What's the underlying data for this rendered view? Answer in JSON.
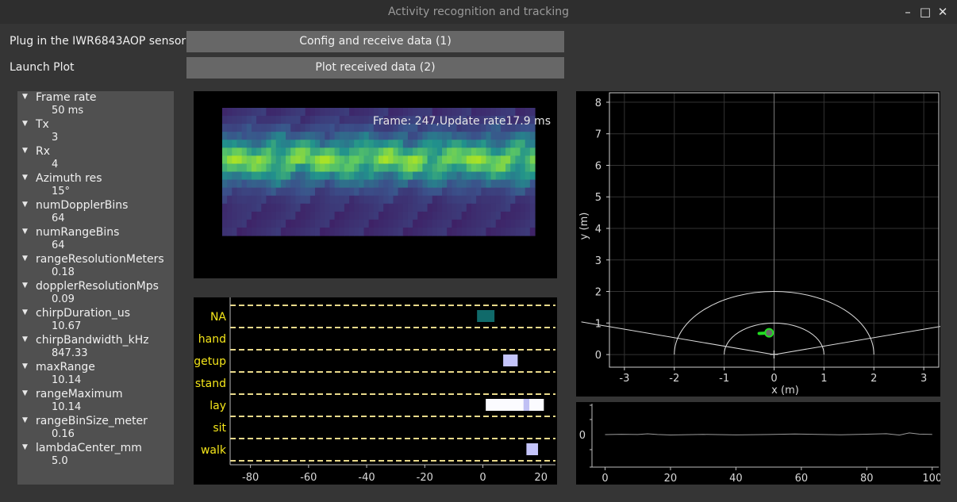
{
  "window": {
    "title": "Activity recognition and tracking"
  },
  "controls": {
    "plug_label": "Plug in the IWR6843AOP sensor",
    "config_button": "Config and receive data (1)",
    "launch_label": "Launch Plot",
    "plot_button": "Plot received data (2)"
  },
  "params": [
    {
      "key": "Frame rate",
      "value": "50 ms"
    },
    {
      "key": "Tx",
      "value": "3"
    },
    {
      "key": "Rx",
      "value": "4"
    },
    {
      "key": "Azimuth res",
      "value": "15°"
    },
    {
      "key": "numDopplerBins",
      "value": "64"
    },
    {
      "key": "numRangeBins",
      "value": "64"
    },
    {
      "key": "rangeResolutionMeters",
      "value": "0.18"
    },
    {
      "key": "dopplerResolutionMps",
      "value": "0.09"
    },
    {
      "key": "chirpDuration_us",
      "value": "10.67"
    },
    {
      "key": "chirpBandwidth_kHz",
      "value": "847.33"
    },
    {
      "key": "maxRange",
      "value": "10.14"
    },
    {
      "key": "rangeMaximum",
      "value": "10.14"
    },
    {
      "key": "rangeBinSize_meter",
      "value": "0.16"
    },
    {
      "key": "lambdaCenter_mm",
      "value": "5.0"
    }
  ],
  "heatmap": {
    "overlay": "Frame: 247,Update rate17.9 ms"
  },
  "colors": {
    "background": "#353535",
    "button": "#676767",
    "tree": "#505050",
    "activity_label": "#f5e61a",
    "dash": "#e9d98a",
    "track": "#22dd22",
    "heat_low": "#3e1f64",
    "heat_high": "#a8e228"
  },
  "chart_data": [
    {
      "type": "heatmap",
      "rows": 16,
      "cols": 64,
      "values": [
        0.05,
        0.1,
        0.2,
        0.35,
        0.55,
        0.8,
        1.0,
        0.8,
        0.55,
        0.35,
        0.2,
        0.1,
        0.05,
        0.03,
        0.02,
        0.02
      ]
    },
    {
      "type": "bar",
      "categories": [
        "NA",
        "hand",
        "getup",
        "stand",
        "lay",
        "sit",
        "walk"
      ],
      "xlim": [
        -87,
        25
      ],
      "xticks": [
        -80,
        -60,
        -40,
        -20,
        0,
        20
      ],
      "segments": [
        {
          "category": "NA",
          "start": -2,
          "end": 4,
          "color": "#106a6a"
        },
        {
          "category": "getup",
          "start": 7,
          "end": 12,
          "color": "#c4c4fa"
        },
        {
          "category": "lay",
          "start": 1,
          "end": 21,
          "color": "#fbfbff"
        },
        {
          "category": "lay",
          "start": 14,
          "end": 16,
          "color": "#c0c0f4"
        },
        {
          "category": "walk",
          "start": 15,
          "end": 19,
          "color": "#c4c4fa"
        }
      ]
    },
    {
      "type": "scatter",
      "xlabel": "x (m)",
      "ylabel": "y (m)",
      "xlim": [
        -3.3,
        3.3
      ],
      "ylim": [
        -0.4,
        8.3
      ],
      "xticks": [
        -3,
        -2,
        -1,
        0,
        1,
        2,
        3
      ],
      "yticks": [
        0,
        1,
        2,
        3,
        4,
        5,
        6,
        7,
        8
      ],
      "grid": true,
      "sensor": {
        "x": 0,
        "y": 0
      },
      "arcs": [
        1,
        2
      ],
      "fov_deg": 75,
      "track": [
        {
          "x": -0.3,
          "y": 0.67
        },
        {
          "x": -0.05,
          "y": 0.69
        }
      ],
      "points": [
        {
          "x": -0.1,
          "y": 0.69
        }
      ]
    },
    {
      "type": "line",
      "xlim": [
        -4,
        102
      ],
      "xticks": [
        0,
        20,
        40,
        60,
        80,
        100
      ],
      "yticks": [
        0
      ],
      "x": [
        0,
        5,
        10,
        13,
        16,
        20,
        30,
        40,
        50,
        58,
        65,
        72,
        80,
        86,
        90,
        93,
        96,
        100
      ],
      "y": [
        0,
        0.3,
        0.1,
        0.8,
        0.1,
        -0.4,
        0.2,
        -0.3,
        0.1,
        0.6,
        0.2,
        -0.2,
        0.4,
        0.9,
        -0.5,
        1.8,
        0.5,
        0.2
      ]
    }
  ]
}
